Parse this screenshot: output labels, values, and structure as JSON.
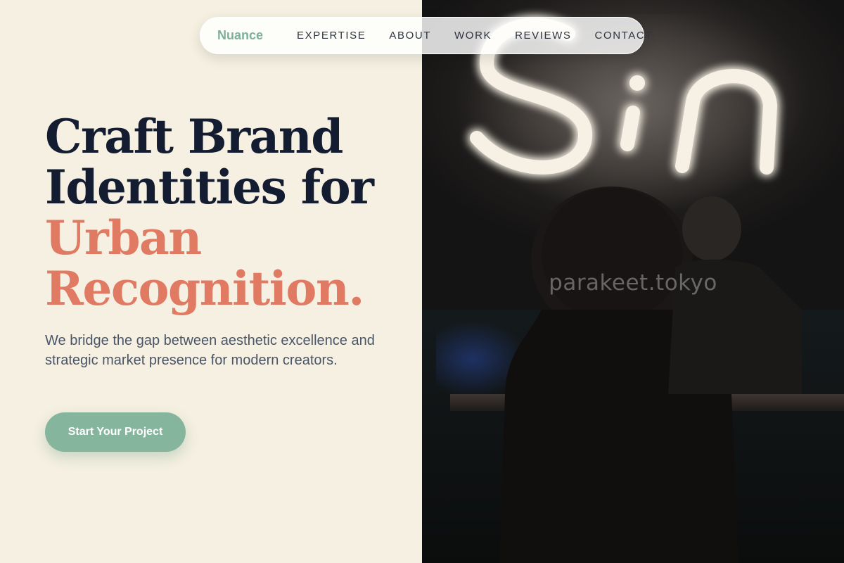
{
  "nav": {
    "brand": "Nuance",
    "items": [
      {
        "label": "EXPERTISE"
      },
      {
        "label": "ABOUT"
      },
      {
        "label": "WORK"
      },
      {
        "label": "REVIEWS"
      },
      {
        "label": "CONTACT"
      }
    ]
  },
  "hero": {
    "headline_line1": "Craft Brand",
    "headline_line2": "Identities for",
    "headline_accent1": "Urban",
    "headline_accent2": "Recognition.",
    "description": "We bridge the gap between aesthetic excellence and strategic market presence for modern creators.",
    "cta_label": "Start Your Project"
  },
  "image": {
    "watermark": "parakeet.tokyo",
    "neon_sign": "Sin"
  },
  "colors": {
    "background": "#f5f0e1",
    "heading": "#131c30",
    "accent": "#e07a62",
    "brand": "#7fb09a",
    "button": "#86b59e",
    "body_text": "#4a5568"
  }
}
